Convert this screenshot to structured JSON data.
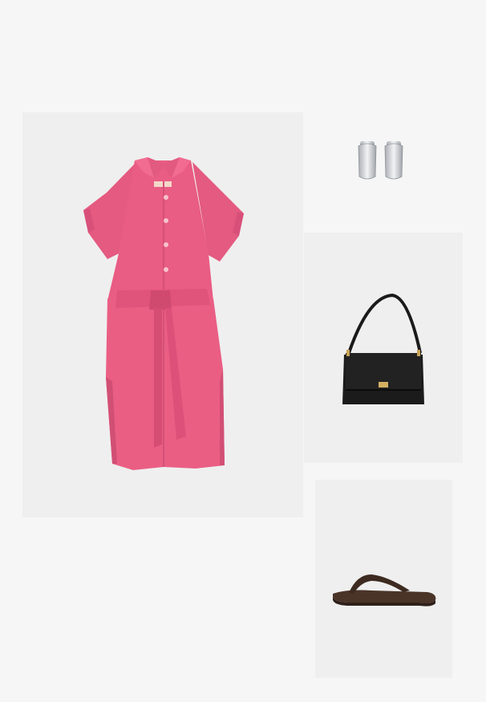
{
  "items": [
    {
      "name": "dress",
      "color": "#e9587d",
      "icon": "dress-icon"
    },
    {
      "name": "earrings",
      "color": "#c9ccd1",
      "icon": "earrings-icon"
    },
    {
      "name": "shoulder-bag",
      "color": "#161616",
      "icon": "bag-icon"
    },
    {
      "name": "sandal",
      "color": "#4a3428",
      "icon": "sandal-icon"
    }
  ]
}
